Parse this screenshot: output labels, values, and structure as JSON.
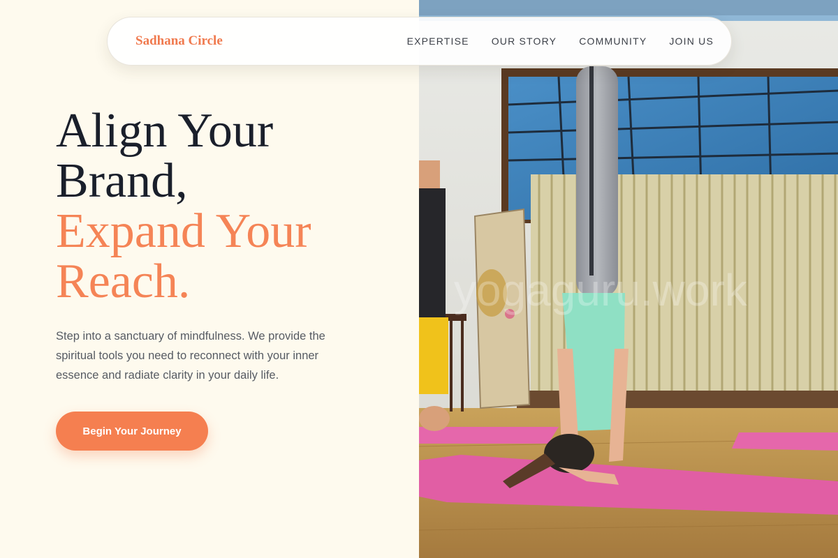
{
  "brand": {
    "name": "Sadhana Circle"
  },
  "nav": {
    "links": [
      "EXPERTISE",
      "OUR STORY",
      "COMMUNITY",
      "JOIN US"
    ]
  },
  "hero": {
    "headline_line1": "Align Your",
    "headline_line2": "Brand,",
    "headline_accent1": "Expand Your",
    "headline_accent2": "Reach.",
    "description": "Step into a sanctuary of mindfulness. We provide the spiritual tools you need to reconnect with your inner essence and radiate clarity in your daily life.",
    "cta_label": "Begin Your Journey",
    "image_watermark": "yogaguru.work"
  },
  "colors": {
    "accent": "#f57f50",
    "background": "#fefaee",
    "heading": "#1a1f2b"
  }
}
